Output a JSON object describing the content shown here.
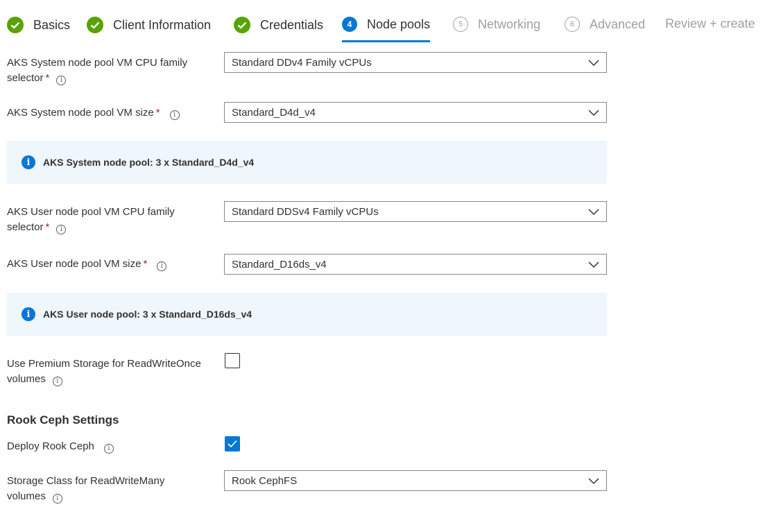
{
  "wizard": {
    "steps": [
      {
        "label": "Basics",
        "state": "done"
      },
      {
        "label": "Client Information",
        "state": "done"
      },
      {
        "label": "Credentials",
        "state": "done"
      },
      {
        "label": "Node pools",
        "state": "active",
        "number": "4"
      },
      {
        "label": "Networking",
        "state": "future",
        "number": "5"
      },
      {
        "label": "Advanced",
        "state": "future",
        "number": "6"
      },
      {
        "label": "Review + create",
        "state": "future"
      }
    ]
  },
  "form": {
    "system_cpu_family": {
      "label_line1": "AKS System node pool VM CPU family",
      "label_line2": "selector",
      "required": "*",
      "value": "Standard DDv4 Family vCPUs"
    },
    "system_vm_size": {
      "label": "AKS System node pool VM size",
      "required": "*",
      "value": "Standard_D4d_v4"
    },
    "system_pool_info": "AKS System node pool: 3 x Standard_D4d_v4",
    "user_cpu_family": {
      "label_line1": "AKS User node pool VM CPU family",
      "label_line2": "selector",
      "required": "*",
      "value": "Standard DDSv4 Family vCPUs"
    },
    "user_vm_size": {
      "label": "AKS User node pool VM size",
      "required": "*",
      "value": "Standard_D16ds_v4"
    },
    "user_pool_info": "AKS User node pool: 3 x Standard_D16ds_v4",
    "premium_storage": {
      "label_line1": "Use Premium Storage for ReadWriteOnce",
      "label_line2": "volumes",
      "checked": false
    },
    "rook_section_title": "Rook Ceph Settings",
    "deploy_rook": {
      "label": "Deploy Rook Ceph",
      "checked": true
    },
    "storage_class": {
      "label_line1": "Storage Class for ReadWriteMany",
      "label_line2": "volumes",
      "value": "Rook CephFS"
    }
  },
  "icons": {
    "info_glyph": "i",
    "check_color": "#57a300",
    "accent_color": "#0078d4"
  }
}
